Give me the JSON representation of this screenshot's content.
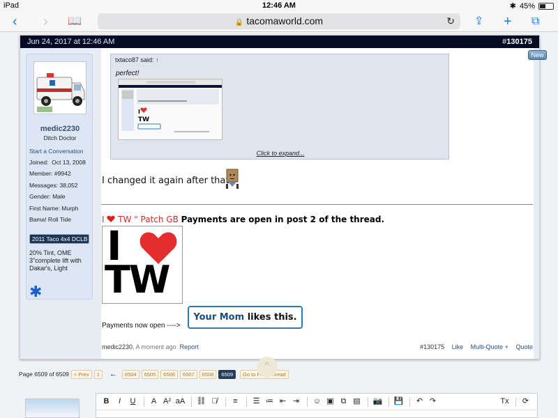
{
  "status_bar": {
    "device": "iPad",
    "time": "12:46 AM",
    "battery": "45%",
    "battery_level": 0.45
  },
  "browser": {
    "url": "tacomaworld.com"
  },
  "post": {
    "date": "Jun 24, 2017 at 12:46 AM",
    "number_prefix": "#",
    "number": "130175",
    "new_badge": "New",
    "user": {
      "username": "medic2230",
      "title": "Ditch Doctor",
      "start_conversation": "Start a Conversation",
      "joined_label": "Joined:",
      "joined": "Oct 13, 2008",
      "member_label": "Member:",
      "member": "#9942",
      "messages_label": "Messages:",
      "messages": "38,052",
      "gender_label": "Gender:",
      "gender": "Male",
      "firstname_label": "First Name:",
      "firstname": "Murph",
      "location": "Bama! Roll Tide",
      "truck": "2011 Taco 4x4 DCLB",
      "mods": "20% Tint, OME 3\"complete lift with Dakar's, Light"
    },
    "quote": {
      "author": "txtaco87 said:",
      "arrow": "↑",
      "text": "perfect!",
      "expand": "Click to expand..."
    },
    "message": "I changed it again after that.",
    "signature": {
      "prefix": "I",
      "mid": " TW \" Patch GB ",
      "bold": "Payments are open in post 2 of the thread.",
      "image_letters_top": "I",
      "image_letters_bottom": "TW",
      "payments_text": "Payments now open ---->",
      "mom_link": "Your Mom",
      "mom_rest": " likes this."
    },
    "footer": {
      "author": "medic2230",
      "time": ", A moment ago",
      "report": "Report",
      "post_num": "#130175",
      "like": "Like",
      "multi_quote": "Multi-Quote +",
      "quote": "Quote"
    }
  },
  "pagination": {
    "page_info": "Page 6509 of 6509",
    "prev": "< Prev",
    "first": "1",
    "arrow": "←",
    "pages": [
      "6504",
      "6505",
      "6506",
      "6507",
      "6508",
      "6509"
    ],
    "current": "6509",
    "go_unread": "Go to First Unread"
  },
  "scroll_top": "^",
  "editor": {
    "buttons": [
      "B",
      "I",
      "U",
      "A",
      "A²",
      "aA",
      "⛓",
      "⛓̸",
      "≡",
      "☰",
      "≔",
      "⇤",
      "⇥",
      "☺",
      "▣",
      "⧉",
      "▤",
      "📷",
      "💾",
      "↶",
      "↷",
      "Tx",
      "⟳"
    ]
  }
}
